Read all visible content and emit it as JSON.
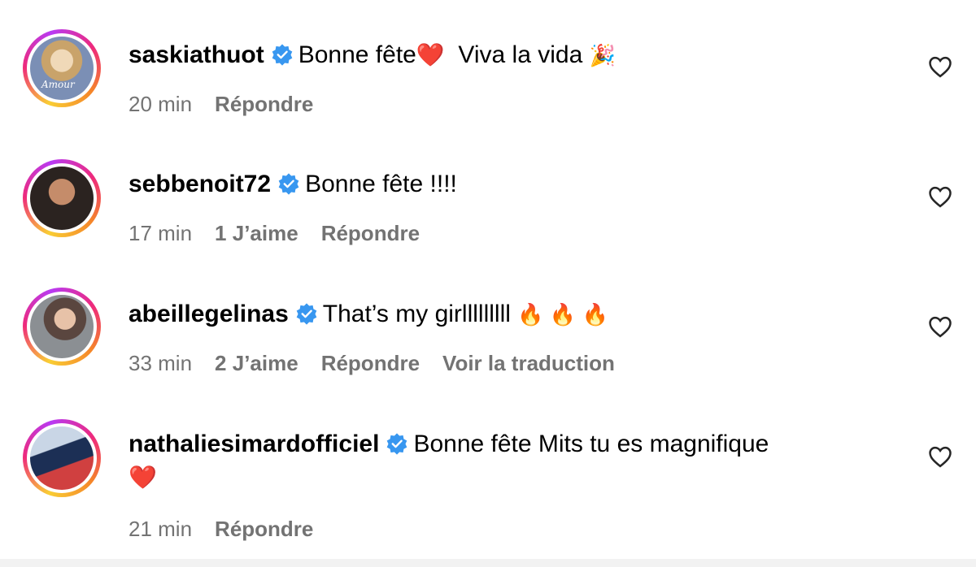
{
  "comments": [
    {
      "username": "saskiathuot",
      "text": "Bonne fête",
      "emoji_after": "❤️",
      "text2": "Viva la vida",
      "emoji_end": "🎉",
      "avatar_caption": "Amour",
      "time": "20 min",
      "likes": "",
      "reply": "Répondre",
      "translate": ""
    },
    {
      "username": "sebbenoit72",
      "text": "Bonne fête !!!!",
      "time": "17 min",
      "likes": "1 J’aime",
      "reply": "Répondre"
    },
    {
      "username": "abeillegelinas",
      "text": "That’s my girlllllllll",
      "emoji_end": "🔥 🔥 🔥",
      "time": "33 min",
      "likes": "2 J’aime",
      "reply": "Répondre",
      "translate": "Voir la traduction"
    },
    {
      "username": "nathaliesimardofficiel",
      "text": "Bonne fête Mits tu es magnifique",
      "emoji_after": "❤️",
      "time": "21 min",
      "reply": "Répondre"
    }
  ],
  "icons": {
    "verified": "verified-badge-icon",
    "like": "heart-outline-icon"
  },
  "colors": {
    "verified": "#3897f0",
    "meta_text": "#737373",
    "heart": "#e0223b"
  }
}
